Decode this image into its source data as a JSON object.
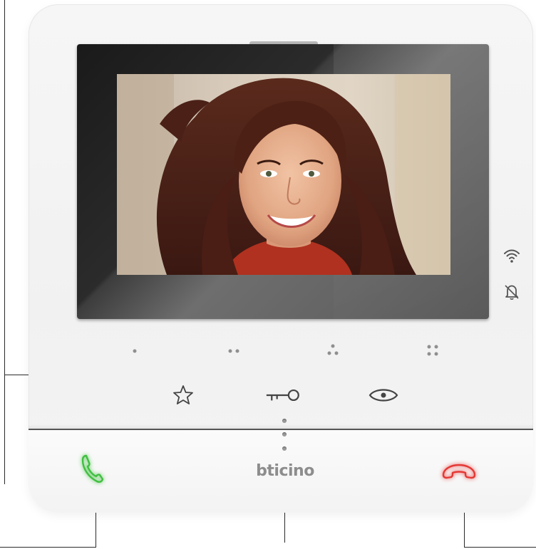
{
  "device": {
    "brand": "bticino"
  },
  "screen": {
    "content": "video-call-visitor"
  },
  "status_icons": [
    {
      "name": "wifi-icon"
    },
    {
      "name": "bell-muted-icon"
    }
  ],
  "touch_keys": [
    {
      "name": "touch-key-1",
      "dots": 1
    },
    {
      "name": "touch-key-2",
      "dots": 2
    },
    {
      "name": "touch-key-3",
      "dots": 3
    },
    {
      "name": "touch-key-4",
      "dots": 4
    }
  ],
  "function_buttons": [
    {
      "name": "favorites-button",
      "icon": "star-icon"
    },
    {
      "name": "door-lock-button",
      "icon": "key-icon"
    },
    {
      "name": "camera-view-button",
      "icon": "eye-icon"
    }
  ],
  "call_buttons": {
    "answer": {
      "icon": "phone-answer-icon",
      "color": "#3fbf3f"
    },
    "hangup": {
      "icon": "phone-hangup-icon",
      "color": "#e53935"
    }
  },
  "colors": {
    "body": "#f3f3f3",
    "bezel": "#2b2b2b",
    "answer_glow": "#3fbf3f",
    "hangup_glow": "#e53935",
    "brand_text": "#8d8d8d"
  }
}
